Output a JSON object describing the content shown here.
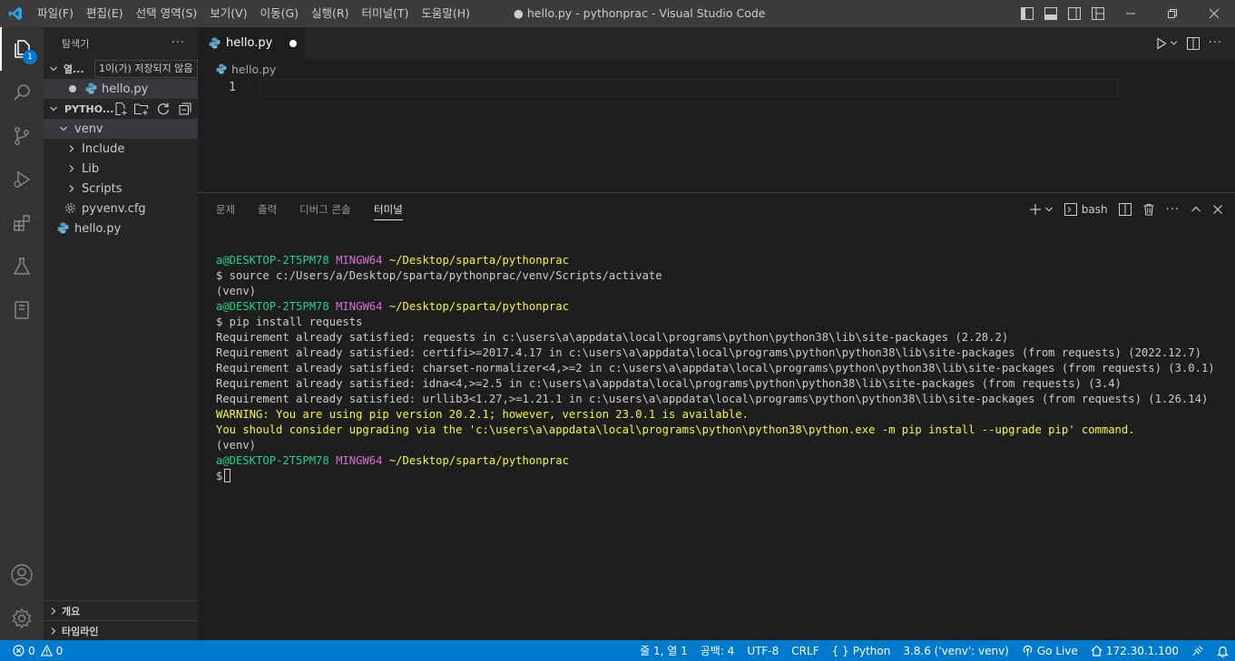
{
  "titlebar": {
    "menu": [
      "파일(F)",
      "편집(E)",
      "선택 영역(S)",
      "보기(V)",
      "이동(G)",
      "실행(R)",
      "터미널(T)",
      "도움말(H)"
    ],
    "title": "● hello.py - pythonprac - Visual Studio Code",
    "accent": "#3c3c3c"
  },
  "activitybar": {
    "explorer_badge": "1",
    "icons": [
      "files-icon",
      "search-icon",
      "source-control-icon",
      "run-debug-icon",
      "extensions-icon",
      "testing-icon",
      "remote-icon",
      "account-icon",
      "gear-icon"
    ]
  },
  "sidebar": {
    "title": "탐색기",
    "more": "···",
    "open_editors": {
      "label": "열...",
      "tooltip": "1이(가) 저장되지 않음",
      "items": [
        {
          "name": "hello.py"
        }
      ]
    },
    "workspace": {
      "label": "PYTHO...",
      "tree": [
        {
          "name": "venv",
          "kind": "folder-open"
        },
        {
          "name": "Include",
          "kind": "folder"
        },
        {
          "name": "Lib",
          "kind": "folder"
        },
        {
          "name": "Scripts",
          "kind": "folder"
        },
        {
          "name": "pyvenv.cfg",
          "kind": "config"
        },
        {
          "name": "hello.py",
          "kind": "python"
        }
      ]
    },
    "outline": "개요",
    "timeline": "타임라인"
  },
  "editor": {
    "tab": {
      "name": "hello.py"
    },
    "breadcrumb": "hello.py",
    "line_number": "1"
  },
  "panel": {
    "tabs": [
      "문제",
      "출력",
      "디버그 콘솔",
      "터미널"
    ],
    "active_tab": "터미널",
    "shell": "bash",
    "terminal": {
      "user_host": "a@DESKTOP-2T5PM78",
      "env": "MINGW64",
      "path": "~/Desktop/sparta/pythonprac",
      "cmd1": "$ source c:/Users/a/Desktop/sparta/pythonprac/venv/Scripts/activate",
      "venv": "(venv)",
      "cmd2": "$ pip install requests",
      "out": [
        "Requirement already satisfied: requests in c:\\users\\a\\appdata\\local\\programs\\python\\python38\\lib\\site-packages (2.28.2)",
        "Requirement already satisfied: certifi>=2017.4.17 in c:\\users\\a\\appdata\\local\\programs\\python\\python38\\lib\\site-packages (from requests) (2022.12.7)",
        "Requirement already satisfied: charset-normalizer<4,>=2 in c:\\users\\a\\appdata\\local\\programs\\python\\python38\\lib\\site-packages (from requests) (3.0.1)",
        "Requirement already satisfied: idna<4,>=2.5 in c:\\users\\a\\appdata\\local\\programs\\python\\python38\\lib\\site-packages (from requests) (3.4)",
        "Requirement already satisfied: urllib3<1.27,>=1.21.1 in c:\\users\\a\\appdata\\local\\programs\\python\\python38\\lib\\site-packages (from requests) (1.26.14)"
      ],
      "warn1": "WARNING: You are using pip version 20.2.1; however, version 23.0.1 is available.",
      "warn2": "You should consider upgrading via the 'c:\\users\\a\\appdata\\local\\programs\\python\\python38\\python.exe -m pip install --upgrade pip' command.",
      "prompt": "$"
    }
  },
  "statusbar": {
    "errors": "0",
    "warnings": "0",
    "position": "줄 1, 열 1",
    "spaces": "공백: 4",
    "encoding": "UTF-8",
    "eol": "CRLF",
    "language": "Python",
    "interpreter": "3.8.6 ('venv': venv)",
    "golive": "Go Live",
    "ip": "172.30.1.100",
    "color": "#007acc"
  }
}
